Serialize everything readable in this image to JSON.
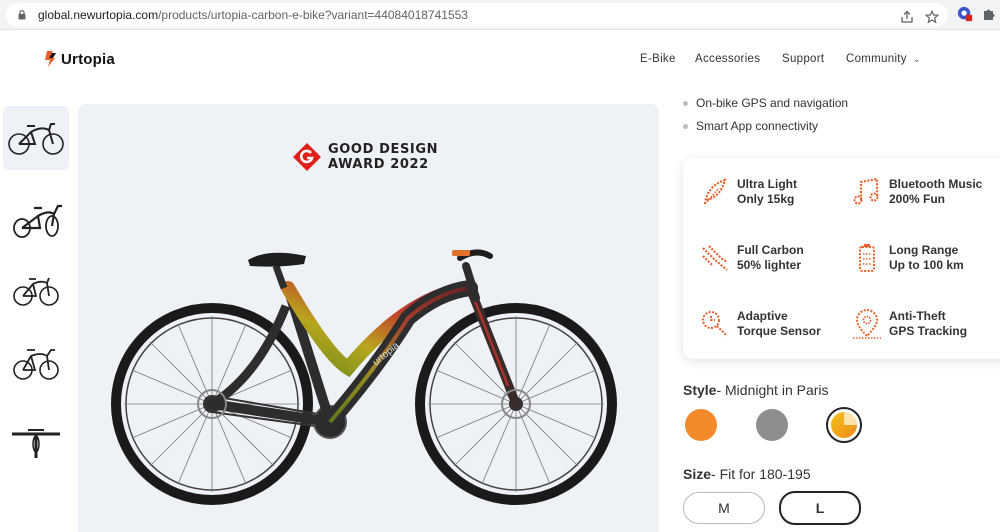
{
  "browser": {
    "url_host": "global.newurtopia.com",
    "url_path": "/products/urtopia-carbon-e-bike?variant=44084018741553"
  },
  "header": {
    "logo_text": "Urtopia",
    "nav": [
      "E-Bike",
      "Accessories",
      "Support",
      "Community"
    ]
  },
  "hero": {
    "award_line1": "GOOD DESIGN",
    "award_line2": "AWARD 2022",
    "frame_text": "urtopia"
  },
  "bullets": [
    "On-bike GPS and navigation",
    "Smart App connectivity"
  ],
  "features": [
    {
      "icon": "feather-icon",
      "line1": "Ultra Light",
      "line2": "Only 15kg"
    },
    {
      "icon": "music-note-icon",
      "line1": "Bluetooth Music",
      "line2": "200% Fun"
    },
    {
      "icon": "carbon-fiber-icon",
      "line1": "Full Carbon",
      "line2": "50% lighter"
    },
    {
      "icon": "battery-icon",
      "line1": "Long Range",
      "line2": "Up to 100 km"
    },
    {
      "icon": "torque-sensor-icon",
      "line1": "Adaptive",
      "line2": "Torque Sensor"
    },
    {
      "icon": "gps-location-icon",
      "line1": "Anti-Theft",
      "line2": "GPS Tracking"
    }
  ],
  "style": {
    "label": "Style",
    "value": "- Midnight in Paris",
    "swatches": [
      {
        "name": "orange",
        "color": "#f28a2b",
        "selected": false
      },
      {
        "name": "grey",
        "color": "#8e8e8e",
        "selected": false
      },
      {
        "name": "midnight-in-paris",
        "color": "#f2a21b",
        "selected": true
      }
    ]
  },
  "size": {
    "label": "Size",
    "value": "- Fit for 180-195",
    "options": [
      {
        "label": "M",
        "selected": false
      },
      {
        "label": "L",
        "selected": true
      }
    ]
  },
  "colors": {
    "accent": "#e8602c",
    "card_bg": "#eef1f6"
  }
}
